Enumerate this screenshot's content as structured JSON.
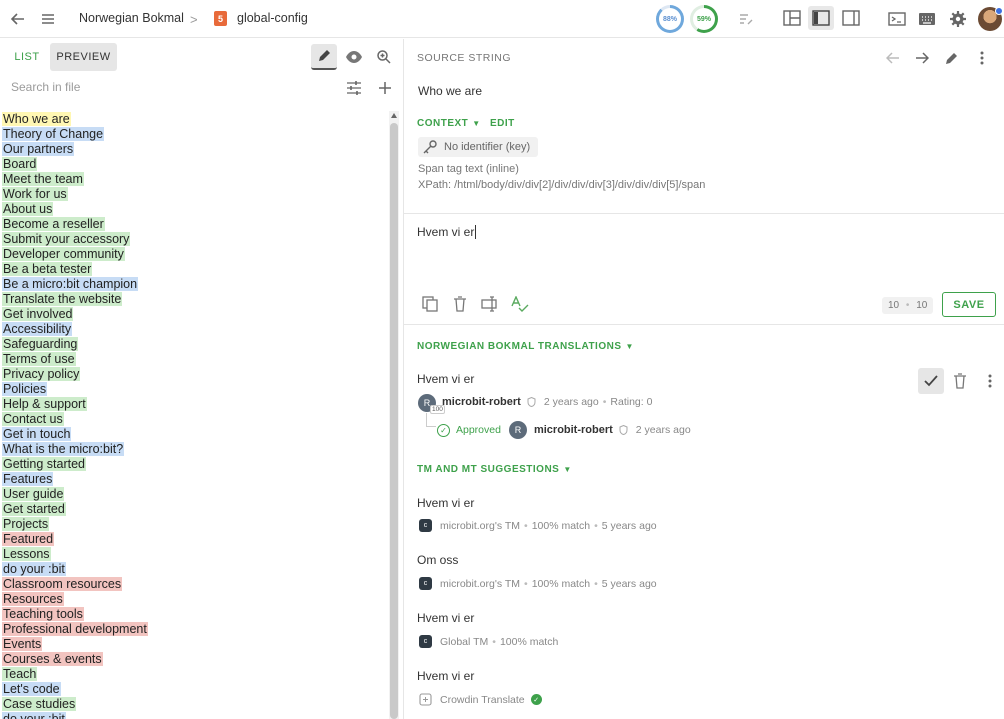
{
  "topbar": {
    "language": "Norwegian Bokmal",
    "file_name": "global-config",
    "file_icon": "html5-icon",
    "translated_progress": "88%",
    "approved_progress": "59%"
  },
  "left_panel": {
    "tabs": {
      "list": "LIST",
      "preview": "PREVIEW"
    },
    "search_placeholder": "Search in file",
    "strings": [
      {
        "text": "Who we are",
        "status": "yellow"
      },
      {
        "text": "Theory of Change",
        "status": "blue"
      },
      {
        "text": "Our partners",
        "status": "blue"
      },
      {
        "text": "Board",
        "status": "green"
      },
      {
        "text": "Meet the team",
        "status": "green"
      },
      {
        "text": "Work for us",
        "status": "green"
      },
      {
        "text": "About us",
        "status": "green"
      },
      {
        "text": "Become a reseller",
        "status": "green"
      },
      {
        "text": "Submit your accessory",
        "status": "green"
      },
      {
        "text": "Developer community",
        "status": "green"
      },
      {
        "text": "Be a beta tester",
        "status": "green"
      },
      {
        "text": "Be a micro:bit champion",
        "status": "blue"
      },
      {
        "text": "Translate the website",
        "status": "green"
      },
      {
        "text": "Get involved",
        "status": "green"
      },
      {
        "text": "Accessibility",
        "status": "blue"
      },
      {
        "text": "Safeguarding",
        "status": "green"
      },
      {
        "text": "Terms of use",
        "status": "green"
      },
      {
        "text": "Privacy policy",
        "status": "green"
      },
      {
        "text": "Policies",
        "status": "blue"
      },
      {
        "text": "Help & support",
        "status": "green"
      },
      {
        "text": "Contact us",
        "status": "green"
      },
      {
        "text": "Get in touch",
        "status": "blue"
      },
      {
        "text": "What is the micro:bit?",
        "status": "blue"
      },
      {
        "text": "Getting started",
        "status": "green"
      },
      {
        "text": "Features",
        "status": "blue"
      },
      {
        "text": "User guide",
        "status": "green"
      },
      {
        "text": "Get started",
        "status": "green"
      },
      {
        "text": "Projects",
        "status": "green"
      },
      {
        "text": "Featured",
        "status": "red"
      },
      {
        "text": "Lessons",
        "status": "green"
      },
      {
        "text": "do your :bit",
        "status": "blue"
      },
      {
        "text": "Classroom resources",
        "status": "red"
      },
      {
        "text": "Resources",
        "status": "red"
      },
      {
        "text": "Teaching tools",
        "status": "red"
      },
      {
        "text": "Professional development",
        "status": "red"
      },
      {
        "text": "Events",
        "status": "red"
      },
      {
        "text": "Courses & events",
        "status": "red"
      },
      {
        "text": "Teach",
        "status": "green"
      },
      {
        "text": "Let's code",
        "status": "blue"
      },
      {
        "text": "Case studies",
        "status": "green"
      },
      {
        "text": "do your :bit",
        "status": "blue"
      }
    ],
    "status_colors": {
      "yellow": "#fff7b3",
      "blue": "#c7dcf5",
      "green": "#cdeccb",
      "red": "#f2c4c0"
    }
  },
  "source": {
    "header": "SOURCE STRING",
    "text": "Who we are",
    "context_label": "CONTEXT",
    "edit_label": "EDIT",
    "identifier": "No identifier (key)",
    "span_info": "Span tag text (inline)",
    "xpath": "XPath: /html/body/div/div[2]/div/div/div[3]/div/div/div[5]/span"
  },
  "editor": {
    "value": "Hvem vi er",
    "counter_left": "10",
    "counter_right": "10",
    "save_label": "SAVE"
  },
  "translations": {
    "header": "NORWEGIAN BOKMAL TRANSLATIONS",
    "item": {
      "text": "Hvem vi er",
      "avatar_letter": "R",
      "badge": "100",
      "user": "microbit-robert",
      "time": "2 years ago",
      "rating": "Rating: 0",
      "approved_label": "Approved",
      "approver": "microbit-robert",
      "approver_time": "2 years ago"
    }
  },
  "suggestions": {
    "header": "TM AND MT SUGGESTIONS",
    "items": [
      {
        "text": "Hvem vi er",
        "source": "microbit.org's TM",
        "match": "100% match",
        "time": "5 years ago"
      },
      {
        "text": "Om oss",
        "source": "microbit.org's TM",
        "match": "100% match",
        "time": "5 years ago"
      },
      {
        "text": "Hvem vi er",
        "source": "Global TM",
        "match": "100% match"
      },
      {
        "text": "Hvem vi er",
        "source": "Crowdin Translate"
      }
    ]
  },
  "accent_color": "#3ea14b"
}
